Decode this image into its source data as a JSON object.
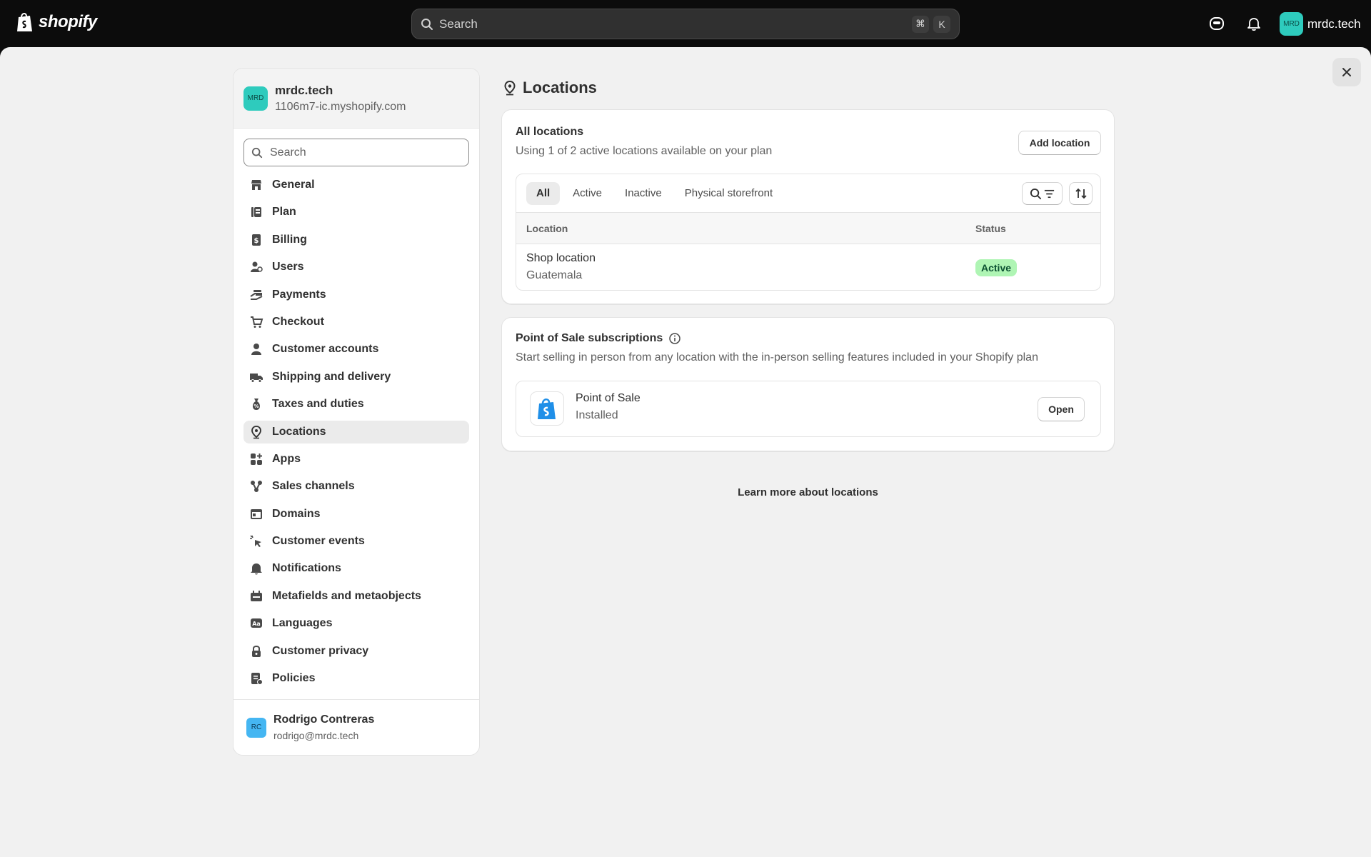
{
  "topbar": {
    "logo_text": "shopify",
    "search_placeholder": "Search",
    "shortcut_keys": [
      "⌘",
      "K"
    ],
    "user_initials": "MRD",
    "user_name": "mrdc.tech"
  },
  "sidebar": {
    "store_initials": "MRD",
    "store_name": "mrdc.tech",
    "store_url": "1106m7-ic.myshopify.com",
    "search_placeholder": "Search",
    "items": [
      {
        "label": "General",
        "icon": "store-icon"
      },
      {
        "label": "Plan",
        "icon": "plan-icon"
      },
      {
        "label": "Billing",
        "icon": "billing-icon"
      },
      {
        "label": "Users",
        "icon": "users-icon"
      },
      {
        "label": "Payments",
        "icon": "payments-icon"
      },
      {
        "label": "Checkout",
        "icon": "cart-icon"
      },
      {
        "label": "Customer accounts",
        "icon": "person-icon"
      },
      {
        "label": "Shipping and delivery",
        "icon": "truck-icon"
      },
      {
        "label": "Taxes and duties",
        "icon": "tax-icon"
      },
      {
        "label": "Locations",
        "icon": "location-icon"
      },
      {
        "label": "Apps",
        "icon": "apps-icon"
      },
      {
        "label": "Sales channels",
        "icon": "channels-icon"
      },
      {
        "label": "Domains",
        "icon": "domains-icon"
      },
      {
        "label": "Customer events",
        "icon": "cursor-icon"
      },
      {
        "label": "Notifications",
        "icon": "bell-icon"
      },
      {
        "label": "Metafields and metaobjects",
        "icon": "metafields-icon"
      },
      {
        "label": "Languages",
        "icon": "language-icon"
      },
      {
        "label": "Customer privacy",
        "icon": "lock-icon"
      },
      {
        "label": "Policies",
        "icon": "policy-icon"
      }
    ],
    "active_item": "Locations",
    "user_initials": "RC",
    "user_name": "Rodrigo Contreras",
    "user_email": "rodrigo@mrdc.tech"
  },
  "main": {
    "title": "Locations",
    "all_locations": {
      "title": "All locations",
      "subtitle": "Using 1 of 2 active locations available on your plan",
      "add_button": "Add location",
      "tabs": [
        "All",
        "Active",
        "Inactive",
        "Physical storefront"
      ],
      "active_tab": "All",
      "columns": [
        "Location",
        "Status"
      ],
      "rows": [
        {
          "name": "Shop location",
          "country": "Guatemala",
          "status": "Active"
        }
      ]
    },
    "pos": {
      "title": "Point of Sale subscriptions",
      "subtitle": "Start selling in person from any location with the in-person selling features included in your Shopify plan",
      "app_name": "Point of Sale",
      "app_status": "Installed",
      "open_button": "Open"
    },
    "learn_more": "Learn more about locations"
  },
  "colors": {
    "accent_teal": "#2ecbbd",
    "active_badge": "#aff5b4",
    "pos_blue": "#1f8fe8"
  }
}
